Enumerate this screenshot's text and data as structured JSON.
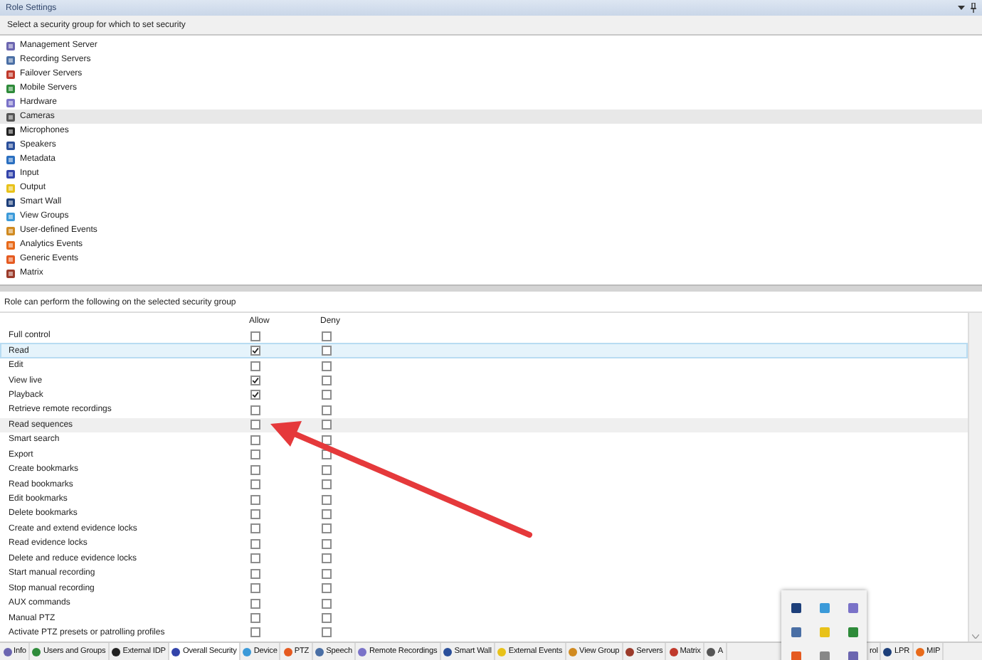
{
  "window": {
    "title": "Role Settings"
  },
  "groups": {
    "heading": "Select a security group for which to set security",
    "items": [
      {
        "label": "Management Server",
        "selected": false
      },
      {
        "label": "Recording Servers",
        "selected": false
      },
      {
        "label": "Failover Servers",
        "selected": false
      },
      {
        "label": "Mobile Servers",
        "selected": false
      },
      {
        "label": "Hardware",
        "selected": false
      },
      {
        "label": "Cameras",
        "selected": true
      },
      {
        "label": "Microphones",
        "selected": false
      },
      {
        "label": "Speakers",
        "selected": false
      },
      {
        "label": "Metadata",
        "selected": false
      },
      {
        "label": "Input",
        "selected": false
      },
      {
        "label": "Output",
        "selected": false
      },
      {
        "label": "Smart Wall",
        "selected": false
      },
      {
        "label": "View Groups",
        "selected": false
      },
      {
        "label": "User-defined Events",
        "selected": false
      },
      {
        "label": "Analytics Events",
        "selected": false
      },
      {
        "label": "Generic Events",
        "selected": false
      },
      {
        "label": "Matrix",
        "selected": false
      }
    ]
  },
  "permissions": {
    "heading": "Role can perform the following on the selected security group",
    "columns": [
      "Allow",
      "Deny"
    ],
    "rows": [
      {
        "label": "Full control",
        "allow": false,
        "deny": false,
        "selected": false,
        "hovered": false
      },
      {
        "label": "Read",
        "allow": true,
        "deny": false,
        "selected": true,
        "hovered": false
      },
      {
        "label": "Edit",
        "allow": false,
        "deny": false,
        "selected": false,
        "hovered": false
      },
      {
        "label": "View live",
        "allow": true,
        "deny": false,
        "selected": false,
        "hovered": false
      },
      {
        "label": "Playback",
        "allow": true,
        "deny": false,
        "selected": false,
        "hovered": false
      },
      {
        "label": "Retrieve remote recordings",
        "allow": false,
        "deny": false,
        "selected": false,
        "hovered": false
      },
      {
        "label": "Read sequences",
        "allow": false,
        "deny": false,
        "selected": false,
        "hovered": true
      },
      {
        "label": "Smart search",
        "allow": false,
        "deny": false,
        "selected": false,
        "hovered": false
      },
      {
        "label": "Export",
        "allow": false,
        "deny": false,
        "selected": false,
        "hovered": false
      },
      {
        "label": "Create bookmarks",
        "allow": false,
        "deny": false,
        "selected": false,
        "hovered": false
      },
      {
        "label": "Read bookmarks",
        "allow": false,
        "deny": false,
        "selected": false,
        "hovered": false
      },
      {
        "label": "Edit bookmarks",
        "allow": false,
        "deny": false,
        "selected": false,
        "hovered": false
      },
      {
        "label": "Delete bookmarks",
        "allow": false,
        "deny": false,
        "selected": false,
        "hovered": false
      },
      {
        "label": "Create and extend evidence locks",
        "allow": false,
        "deny": false,
        "selected": false,
        "hovered": false
      },
      {
        "label": "Read evidence locks",
        "allow": false,
        "deny": false,
        "selected": false,
        "hovered": false
      },
      {
        "label": "Delete and reduce evidence locks",
        "allow": false,
        "deny": false,
        "selected": false,
        "hovered": false
      },
      {
        "label": "Start manual recording",
        "allow": false,
        "deny": false,
        "selected": false,
        "hovered": false
      },
      {
        "label": "Stop manual recording",
        "allow": false,
        "deny": false,
        "selected": false,
        "hovered": false
      },
      {
        "label": "AUX commands",
        "allow": false,
        "deny": false,
        "selected": false,
        "hovered": false
      },
      {
        "label": "Manual PTZ",
        "allow": false,
        "deny": false,
        "selected": false,
        "hovered": false
      },
      {
        "label": "Activate PTZ presets or patrolling profiles",
        "allow": false,
        "deny": false,
        "selected": false,
        "hovered": false
      }
    ]
  },
  "tabs": [
    {
      "label": "Info",
      "selected": false,
      "kind": "full"
    },
    {
      "label": "Users and Groups",
      "selected": false,
      "kind": "full"
    },
    {
      "label": "External IDP",
      "selected": false,
      "kind": "full"
    },
    {
      "label": "Overall Security",
      "selected": true,
      "kind": "full"
    },
    {
      "label": "Device",
      "selected": false,
      "kind": "full"
    },
    {
      "label": "PTZ",
      "selected": false,
      "kind": "full"
    },
    {
      "label": "Speech",
      "selected": false,
      "kind": "full"
    },
    {
      "label": "Remote Recordings",
      "selected": false,
      "kind": "full"
    },
    {
      "label": "Smart Wall",
      "selected": false,
      "kind": "full"
    },
    {
      "label": "External Events",
      "selected": false,
      "kind": "full"
    },
    {
      "label": "View Group",
      "selected": false,
      "kind": "full"
    },
    {
      "label": "Servers",
      "selected": false,
      "kind": "full"
    },
    {
      "label": "Matrix",
      "selected": false,
      "kind": "full"
    },
    {
      "label": "A",
      "selected": false,
      "kind": "cut-right"
    },
    {
      "label": "rol",
      "selected": false,
      "kind": "cut-left"
    },
    {
      "label": "LPR",
      "selected": false,
      "kind": "full"
    },
    {
      "label": "MIP",
      "selected": false,
      "kind": "full"
    }
  ]
}
